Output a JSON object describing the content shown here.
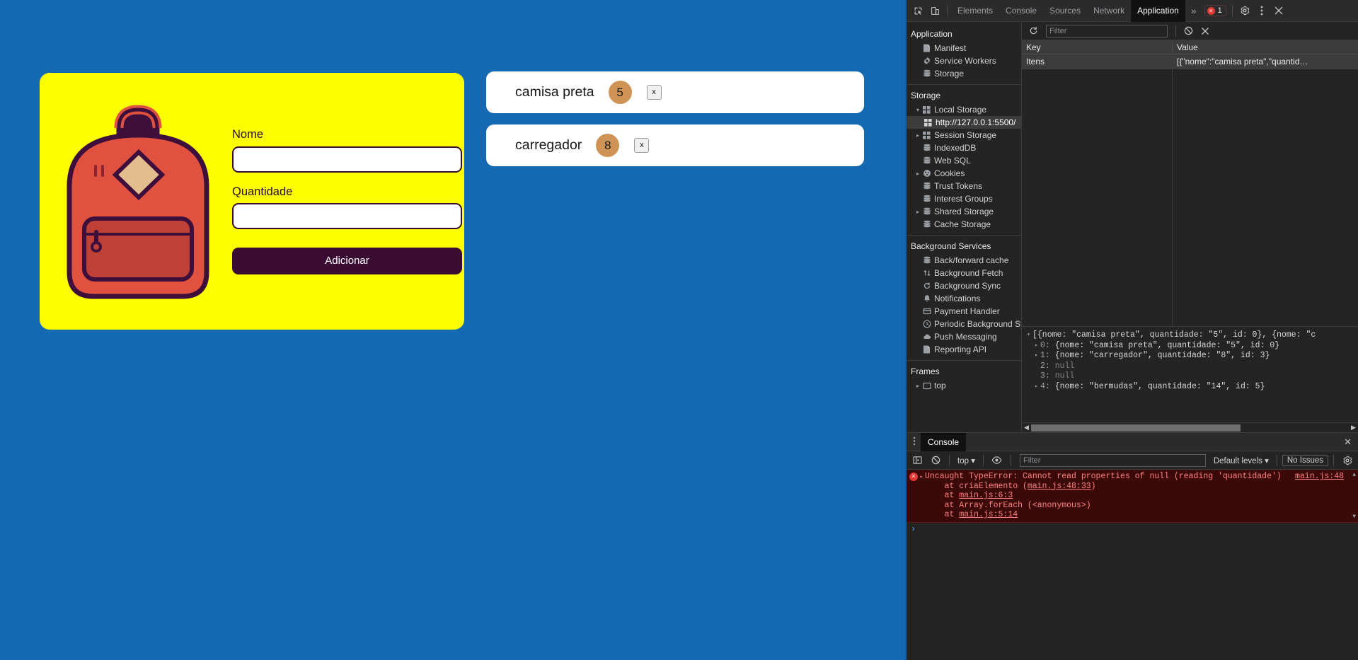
{
  "page": {
    "background_color": "#1569b2",
    "form": {
      "card_color": "#fbff00",
      "illustration": "backpack-illustration",
      "name_label": "Nome",
      "name_value": "",
      "name_placeholder": "",
      "qty_label": "Quantidade",
      "qty_value": "",
      "qty_placeholder": "",
      "submit_label": "Adicionar",
      "submit_color": "#3a0c33"
    },
    "items": [
      {
        "name": "camisa preta",
        "quantity": "5",
        "delete_label": "x"
      },
      {
        "name": "carregador",
        "quantity": "8",
        "delete_label": "x"
      }
    ],
    "badge_color": "#cf9455"
  },
  "devtools": {
    "tabs": [
      {
        "label": "Elements",
        "active": false
      },
      {
        "label": "Console",
        "active": false
      },
      {
        "label": "Sources",
        "active": false
      },
      {
        "label": "Network",
        "active": false
      },
      {
        "label": "Application",
        "active": true
      }
    ],
    "more_tabs_label": "»",
    "error_count": "1",
    "icons": {
      "inspect": "inspect-element-icon",
      "device": "device-toolbar-icon",
      "settings": "gear-icon",
      "kebab": "kebab-menu-icon",
      "close": "close-icon"
    },
    "sidebar": {
      "sections": [
        {
          "title": "Application",
          "items": [
            {
              "label": "Manifest",
              "icon": "manifest-file-icon",
              "arrow": false,
              "selected": false
            },
            {
              "label": "Service Workers",
              "icon": "gear-icon",
              "arrow": false,
              "selected": false
            },
            {
              "label": "Storage",
              "icon": "database-icon",
              "arrow": false,
              "selected": false
            }
          ]
        },
        {
          "title": "Storage",
          "items": [
            {
              "label": "Local Storage",
              "icon": "table-icon",
              "arrow": "▾",
              "selected": false
            },
            {
              "label": "http://127.0.0.1:5500/",
              "icon": "table-icon",
              "arrow": false,
              "selected": true,
              "sub": true
            },
            {
              "label": "Session Storage",
              "icon": "table-icon",
              "arrow": "▸",
              "selected": false
            },
            {
              "label": "IndexedDB",
              "icon": "database-icon",
              "arrow": false,
              "selected": false
            },
            {
              "label": "Web SQL",
              "icon": "database-icon",
              "arrow": false,
              "selected": false
            },
            {
              "label": "Cookies",
              "icon": "cookie-icon",
              "arrow": "▸",
              "selected": false
            },
            {
              "label": "Trust Tokens",
              "icon": "database-icon",
              "arrow": false,
              "selected": false
            },
            {
              "label": "Interest Groups",
              "icon": "database-icon",
              "arrow": false,
              "selected": false
            },
            {
              "label": "Shared Storage",
              "icon": "database-icon",
              "arrow": "▸",
              "selected": false
            },
            {
              "label": "Cache Storage",
              "icon": "database-icon",
              "arrow": false,
              "selected": false
            }
          ]
        },
        {
          "title": "Background Services",
          "items": [
            {
              "label": "Back/forward cache",
              "icon": "database-icon",
              "arrow": false,
              "selected": false
            },
            {
              "label": "Background Fetch",
              "icon": "up-down-arrows-icon",
              "arrow": false,
              "selected": false
            },
            {
              "label": "Background Sync",
              "icon": "sync-icon",
              "arrow": false,
              "selected": false
            },
            {
              "label": "Notifications",
              "icon": "bell-icon",
              "arrow": false,
              "selected": false
            },
            {
              "label": "Payment Handler",
              "icon": "credit-card-icon",
              "arrow": false,
              "selected": false
            },
            {
              "label": "Periodic Background Sync",
              "icon": "clock-icon",
              "arrow": false,
              "selected": false
            },
            {
              "label": "Push Messaging",
              "icon": "cloud-icon",
              "arrow": false,
              "selected": false
            },
            {
              "label": "Reporting API",
              "icon": "manifest-file-icon",
              "arrow": false,
              "selected": false
            }
          ]
        },
        {
          "title": "Frames",
          "items": [
            {
              "label": "top",
              "icon": "frame-icon",
              "arrow": "▸",
              "selected": false
            }
          ]
        }
      ]
    },
    "storage_panel": {
      "toolbar": {
        "refresh_icon": "refresh-icon",
        "filter_placeholder": "Filter",
        "filter_value": "",
        "clear_icon": "clear-all-icon",
        "delete_icon": "delete-selected-icon"
      },
      "columns": [
        "Key",
        "Value"
      ],
      "rows": [
        {
          "key": "Itens",
          "value": "[{\"nome\":\"camisa preta\",\"quantid…",
          "selected": true
        }
      ]
    },
    "preview": {
      "root": "[{nome: \"camisa preta\", quantidade: \"5\", id: 0}, {nome: \"c",
      "entries": [
        {
          "index": "0",
          "expandable": true,
          "text": "{nome: \"camisa preta\", quantidade: \"5\", id: 0}"
        },
        {
          "index": "1",
          "expandable": true,
          "text": "{nome: \"carregador\", quantidade: \"8\", id: 3}"
        },
        {
          "index": "2",
          "expandable": false,
          "text": "null"
        },
        {
          "index": "3",
          "expandable": false,
          "text": "null"
        },
        {
          "index": "4",
          "expandable": true,
          "text": "{nome: \"bermudas\", quantidade: \"14\", id: 5}"
        }
      ]
    },
    "drawer": {
      "tab_label": "Console",
      "close_label": "✕",
      "toolbar": {
        "sidebar_icon": "console-sidebar-icon",
        "clear_icon": "clear-console-icon",
        "context": "top",
        "eye_icon": "live-expression-icon",
        "filter_placeholder": "Filter",
        "filter_value": "",
        "levels_label": "Default levels",
        "issues_label": "No Issues",
        "settings_icon": "gear-icon"
      },
      "error": {
        "message": "Uncaught TypeError: Cannot read properties of null (reading 'quantidade')",
        "source": "main.js:48",
        "stack": [
          {
            "prefix": "    at criaElemento (",
            "link": "main.js:48:33",
            "suffix": ")"
          },
          {
            "prefix": "    at ",
            "link": "main.js:6:3",
            "suffix": ""
          },
          {
            "prefix": "    at Array.forEach (<anonymous>)",
            "link": "",
            "suffix": ""
          },
          {
            "prefix": "    at ",
            "link": "main.js:5:14",
            "suffix": ""
          }
        ]
      },
      "prompt": "›"
    }
  }
}
